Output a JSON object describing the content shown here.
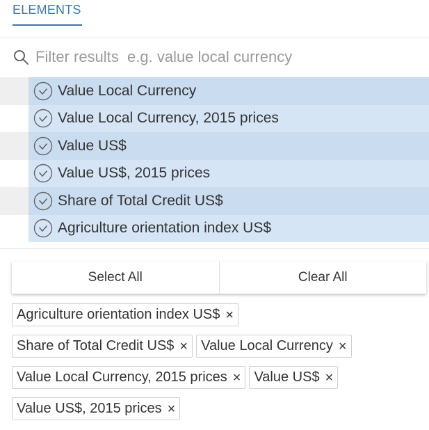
{
  "tabs": {
    "active_label": "ELEMENTS"
  },
  "filter": {
    "placeholder": "Filter results  e.g. value local currency",
    "icon": "search-icon"
  },
  "elements": [
    {
      "label": "Value Local Currency",
      "selected": true
    },
    {
      "label": "Value Local Currency, 2015 prices",
      "selected": true
    },
    {
      "label": "Value US$",
      "selected": true
    },
    {
      "label": "Value US$, 2015 prices",
      "selected": true
    },
    {
      "label": "Share of Total Credit US$",
      "selected": true
    },
    {
      "label": "Agriculture orientation index US$",
      "selected": true
    }
  ],
  "actions": {
    "select_all": "Select All",
    "clear_all": "Clear All"
  },
  "chips": [
    {
      "label": "Agriculture orientation index US$",
      "remove": "×"
    },
    {
      "label": "Share of Total Credit US$",
      "remove": "×"
    },
    {
      "label": "Value Local Currency",
      "remove": "×"
    },
    {
      "label": "Value Local Currency, 2015 prices",
      "remove": "×"
    },
    {
      "label": "Value US$",
      "remove": "×"
    },
    {
      "label": "Value US$, 2015 prices",
      "remove": "×"
    }
  ],
  "colors": {
    "accent": "#3a78b4",
    "selected_row": "#c9dcf0",
    "selected_row_alt": "#d6e5f5"
  }
}
